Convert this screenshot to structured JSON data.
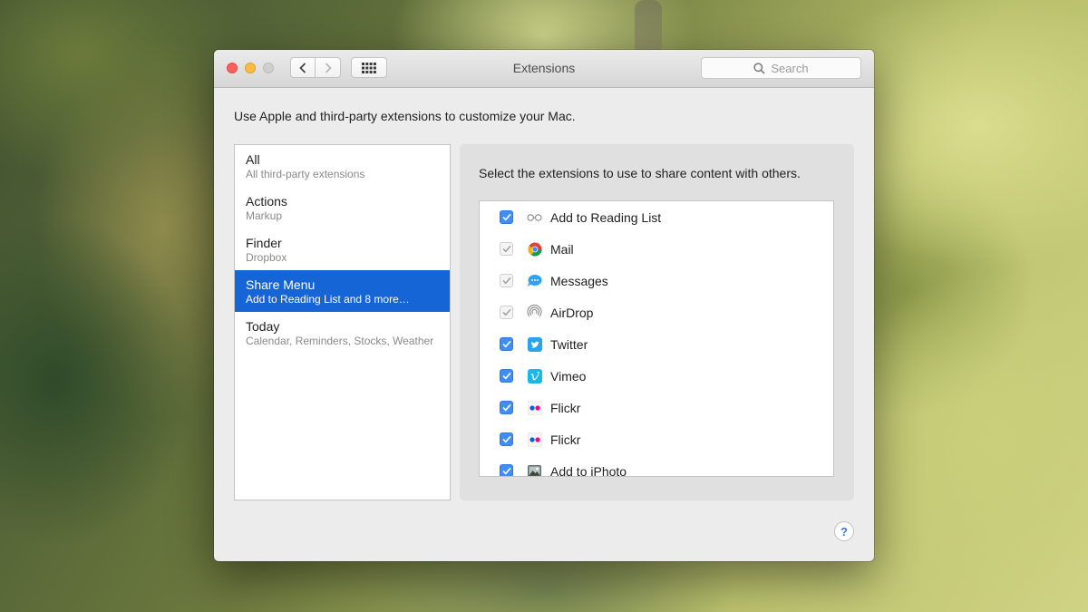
{
  "window": {
    "title": "Extensions",
    "search_placeholder": "Search",
    "intro": "Use Apple and third-party extensions to customize your Mac."
  },
  "categories": [
    {
      "title": "All",
      "subtitle": "All third-party extensions",
      "selected": false
    },
    {
      "title": "Actions",
      "subtitle": "Markup",
      "selected": false
    },
    {
      "title": "Finder",
      "subtitle": "Dropbox",
      "selected": false
    },
    {
      "title": "Share Menu",
      "subtitle": "Add to Reading List and 8 more…",
      "selected": true
    },
    {
      "title": "Today",
      "subtitle": "Calendar, Reminders, Stocks, Weather",
      "selected": false
    }
  ],
  "detail": {
    "header": "Select the extensions to use to share content with others.",
    "extensions": [
      {
        "label": "Add to Reading List",
        "checked": true,
        "enabled": true,
        "icon": "reading-list-icon"
      },
      {
        "label": "Mail",
        "checked": true,
        "enabled": false,
        "icon": "mail-icon"
      },
      {
        "label": "Messages",
        "checked": true,
        "enabled": false,
        "icon": "messages-icon"
      },
      {
        "label": "AirDrop",
        "checked": true,
        "enabled": false,
        "icon": "airdrop-icon"
      },
      {
        "label": "Twitter",
        "checked": true,
        "enabled": true,
        "icon": "twitter-icon"
      },
      {
        "label": "Vimeo",
        "checked": true,
        "enabled": true,
        "icon": "vimeo-icon"
      },
      {
        "label": "Flickr",
        "checked": true,
        "enabled": true,
        "icon": "flickr-icon"
      },
      {
        "label": "Flickr",
        "checked": true,
        "enabled": true,
        "icon": "flickr-icon"
      },
      {
        "label": "Add to iPhoto",
        "checked": true,
        "enabled": true,
        "icon": "iphoto-icon"
      }
    ]
  },
  "help": {
    "label": "?"
  },
  "colors": {
    "selection": "#1565d6",
    "checkbox": "#3f8ef5"
  }
}
